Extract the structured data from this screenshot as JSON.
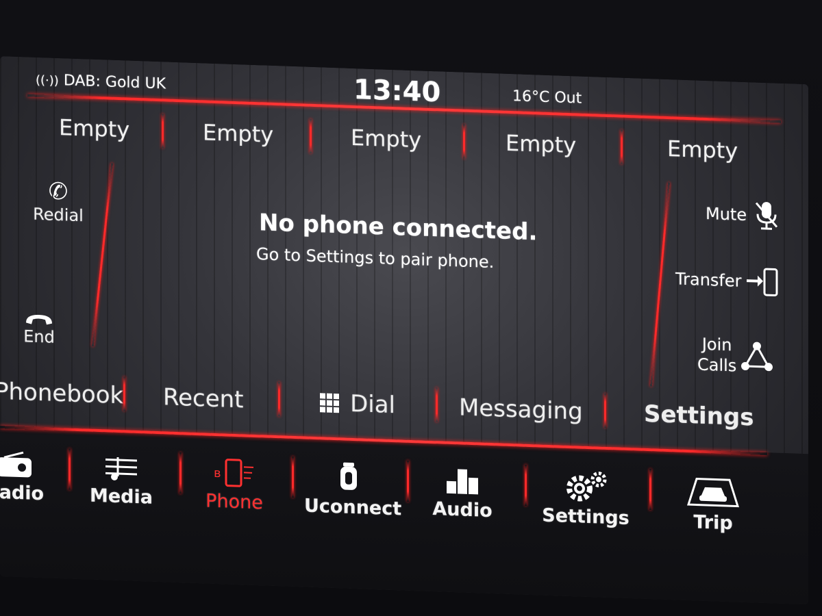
{
  "status": {
    "radio": "DAB: Gold UK",
    "time": "13:40",
    "temperature": "16°C Out"
  },
  "presets": [
    "Empty",
    "Empty",
    "Empty",
    "Empty",
    "Empty"
  ],
  "left_controls": {
    "redial": "Redial",
    "end": "End"
  },
  "main": {
    "title": "No phone connected.",
    "subtitle": "Go to Settings to pair phone."
  },
  "right_controls": {
    "mute": "Mute",
    "transfer": "Transfer",
    "join_line1": "Join",
    "join_line2": "Calls"
  },
  "tabs": {
    "phonebook": "Phonebook",
    "recent": "Recent",
    "dial": "Dial",
    "messaging": "Messaging",
    "settings": "Settings"
  },
  "nav": {
    "radio": "Radio",
    "media": "Media",
    "phone": "Phone",
    "uconnect": "Uconnect",
    "audio": "Audio",
    "settings": "Settings",
    "trip": "Trip"
  },
  "colors": {
    "accent": "#ff2a2a",
    "active_nav": "#ff3030"
  }
}
